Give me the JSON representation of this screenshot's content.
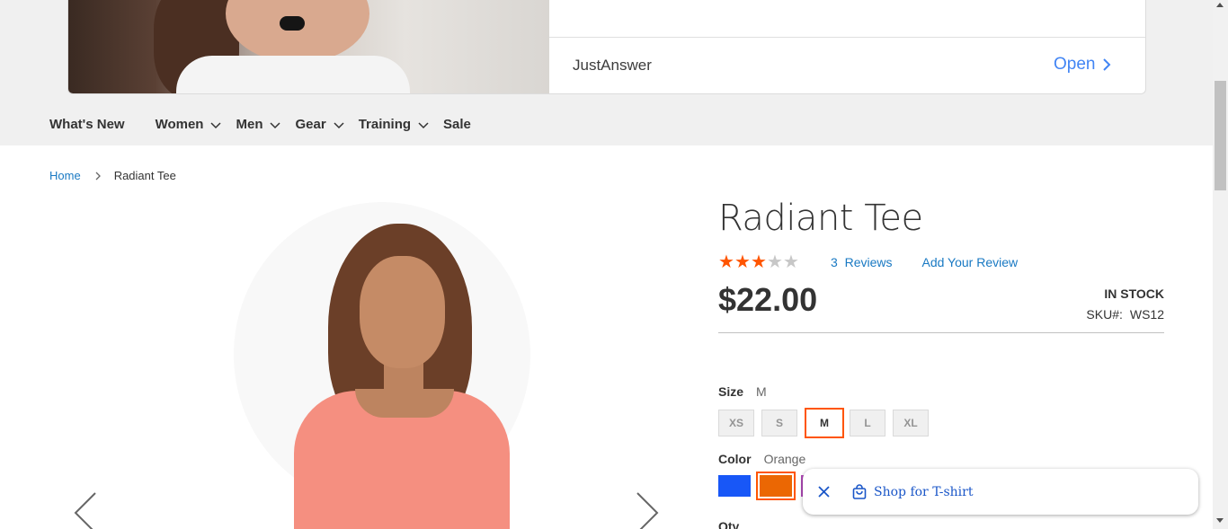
{
  "ad": {
    "advertiser": "JustAnswer",
    "open_label": "Open",
    "open_color": "#4285f4"
  },
  "nav": {
    "items": [
      {
        "label": "What's New",
        "has_dropdown": false
      },
      {
        "label": "Women",
        "has_dropdown": true
      },
      {
        "label": "Men",
        "has_dropdown": true
      },
      {
        "label": "Gear",
        "has_dropdown": true
      },
      {
        "label": "Training",
        "has_dropdown": true
      },
      {
        "label": "Sale",
        "has_dropdown": false
      }
    ]
  },
  "breadcrumb": {
    "home": "Home",
    "current": "Radiant Tee"
  },
  "product": {
    "title": "Radiant Tee",
    "rating": 3,
    "rating_max": 5,
    "reviews_count": "3",
    "reviews_label": "Reviews",
    "add_review_label": "Add Your Review",
    "price": "$22.00",
    "stock": "IN STOCK",
    "sku_label": "SKU#:",
    "sku": "WS12",
    "size_label": "Size",
    "size_selected": "M",
    "sizes": [
      "XS",
      "S",
      "M",
      "L",
      "XL"
    ],
    "color_label": "Color",
    "color_selected": "Orange",
    "color_swatches": [
      "#1857f7",
      "#eb6703",
      "#b04ab8"
    ],
    "qty_label": "Qty"
  },
  "shopping_chip": {
    "text": "Shop for T-shirt"
  },
  "colors": {
    "accent": "#ff5501",
    "link": "#1979c3",
    "chip_text": "#1a56c8"
  }
}
